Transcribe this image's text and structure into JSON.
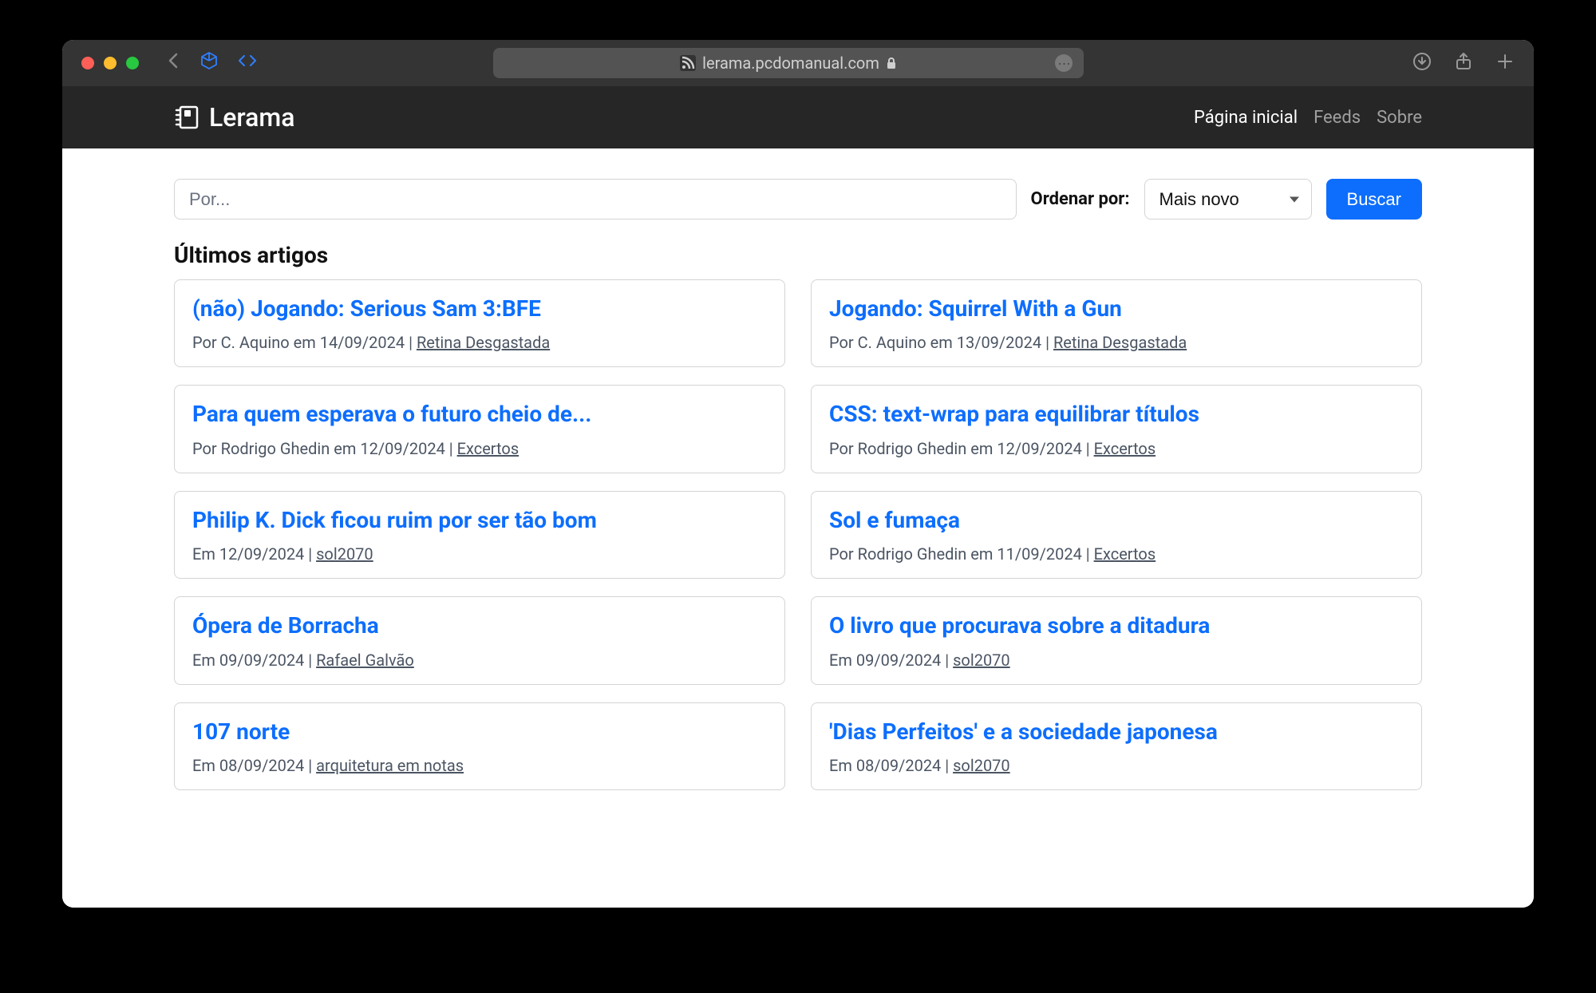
{
  "browser": {
    "url": "lerama.pcdomanual.com"
  },
  "header": {
    "brand": "Lerama",
    "nav": [
      {
        "label": "Página inicial",
        "active": true
      },
      {
        "label": "Feeds",
        "active": false
      },
      {
        "label": "Sobre",
        "active": false
      }
    ]
  },
  "search": {
    "placeholder": "Por...",
    "sort_label": "Ordenar por:",
    "sort_selected": "Mais novo",
    "button": "Buscar"
  },
  "section_title": "Últimos artigos",
  "articles": [
    {
      "title": "(não) Jogando: Serious Sam 3:BFE",
      "meta": "Por C. Aquino em 14/09/2024 | ",
      "source": "Retina Desgastada"
    },
    {
      "title": "Jogando: Squirrel With a Gun",
      "meta": "Por C. Aquino em 13/09/2024 | ",
      "source": "Retina Desgastada"
    },
    {
      "title": "Para quem esperava o futuro cheio de...",
      "meta": "Por Rodrigo Ghedin em 12/09/2024 | ",
      "source": "Excertos"
    },
    {
      "title": "CSS: text-wrap para equilibrar títulos",
      "meta": "Por Rodrigo Ghedin em 12/09/2024 | ",
      "source": "Excertos"
    },
    {
      "title": "Philip K. Dick ficou ruim por ser tão bom",
      "meta": "Em 12/09/2024 | ",
      "source": "sol2070"
    },
    {
      "title": "Sol e fumaça",
      "meta": "Por Rodrigo Ghedin em 11/09/2024 | ",
      "source": "Excertos"
    },
    {
      "title": "Ópera de Borracha",
      "meta": "Em 09/09/2024 | ",
      "source": "Rafael Galvão"
    },
    {
      "title": "O livro que procurava sobre a ditadura",
      "meta": "Em 09/09/2024 | ",
      "source": "sol2070"
    },
    {
      "title": "107 norte",
      "meta": "Em 08/09/2024 | ",
      "source": "arquitetura em notas"
    },
    {
      "title": "'Dias Perfeitos' e a sociedade japonesa",
      "meta": "Em 08/09/2024 | ",
      "source": "sol2070"
    }
  ]
}
